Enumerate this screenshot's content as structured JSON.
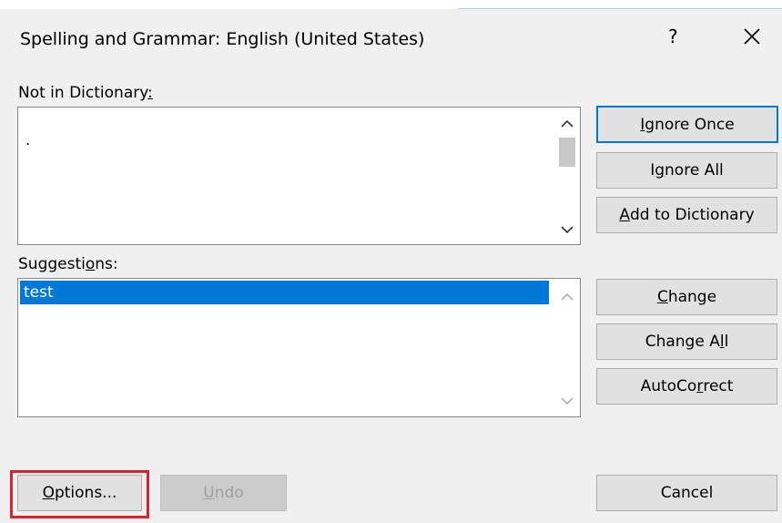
{
  "dialog": {
    "title": "Spelling and Grammar: English (United States)",
    "help_label": "?",
    "close_icon": "close-icon"
  },
  "not_in_dictionary": {
    "label_pre": "Not in Dictionary",
    "label_u": ":",
    "label_post": "",
    "text": "."
  },
  "suggestions": {
    "label_pre": "Suggesti",
    "label_u": "o",
    "label_post": "ns:",
    "items": [
      "test"
    ],
    "selected_color": "#0078d7"
  },
  "buttons": {
    "ignore_once": {
      "pre": "",
      "u": "I",
      "post": "gnore Once"
    },
    "ignore_all": {
      "pre": "I",
      "u": "g",
      "post": "nore All"
    },
    "add_to_dictionary": {
      "pre": "",
      "u": "A",
      "post": "dd to Dictionary"
    },
    "change": {
      "pre": "",
      "u": "C",
      "post": "hange"
    },
    "change_all": {
      "pre": "Change A",
      "u": "l",
      "post": "l"
    },
    "autocorrect": {
      "pre": "AutoCo",
      "u": "r",
      "post": "rect"
    },
    "options": {
      "pre": "",
      "u": "O",
      "post": "ptions..."
    },
    "undo": {
      "pre": "",
      "u": "U",
      "post": "ndo"
    },
    "cancel": {
      "pre": "Cancel",
      "u": "",
      "post": ""
    }
  },
  "colors": {
    "accent": "#0078d7",
    "highlight_box": "#d9232e"
  }
}
